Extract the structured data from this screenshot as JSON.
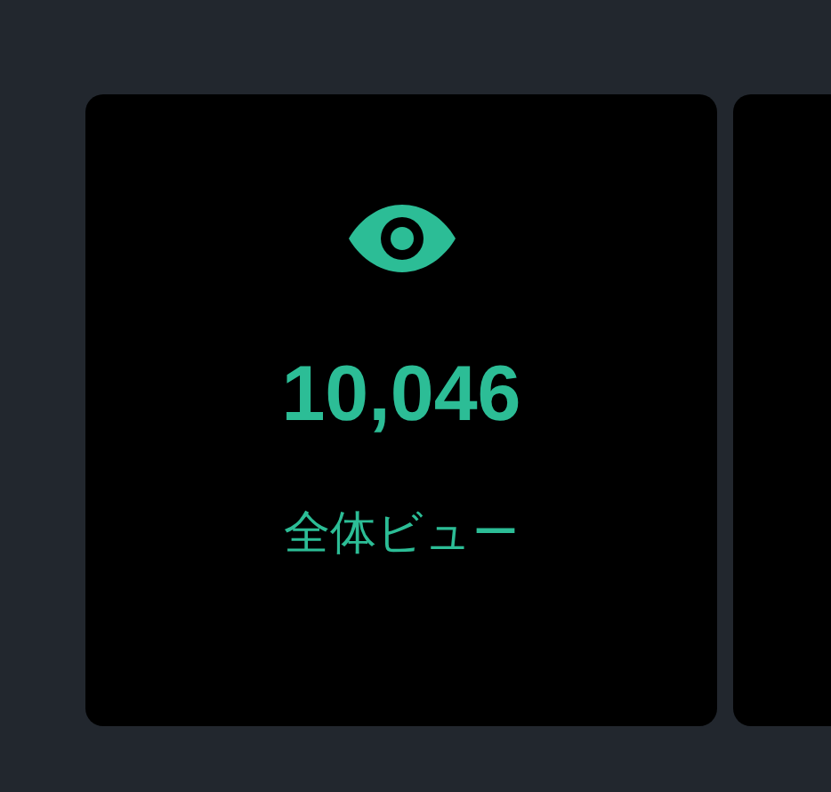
{
  "cards": [
    {
      "kind": "stat",
      "value": "10,046",
      "label": "全体ビュー"
    },
    {
      "kind": "blank"
    }
  ]
}
